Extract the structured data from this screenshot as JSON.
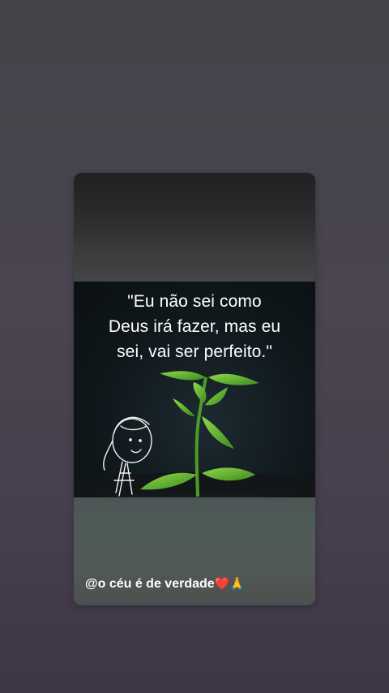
{
  "post": {
    "quote": "\"Eu não sei como\nDeus irá fazer, mas eu\nsei, vai ser perfeito.\"",
    "caption_text": "@o céu é de verdade",
    "caption_heart": "❤️",
    "caption_pray": "🙏"
  },
  "icons": {
    "illustration": "plant-sprout-illustration",
    "figure": "stick-figure-girl-illustration"
  },
  "colors": {
    "background": "#45434a",
    "quote_text": "#ffffff",
    "leaf_green": "#5fae2e",
    "heart": "#e0243a"
  }
}
